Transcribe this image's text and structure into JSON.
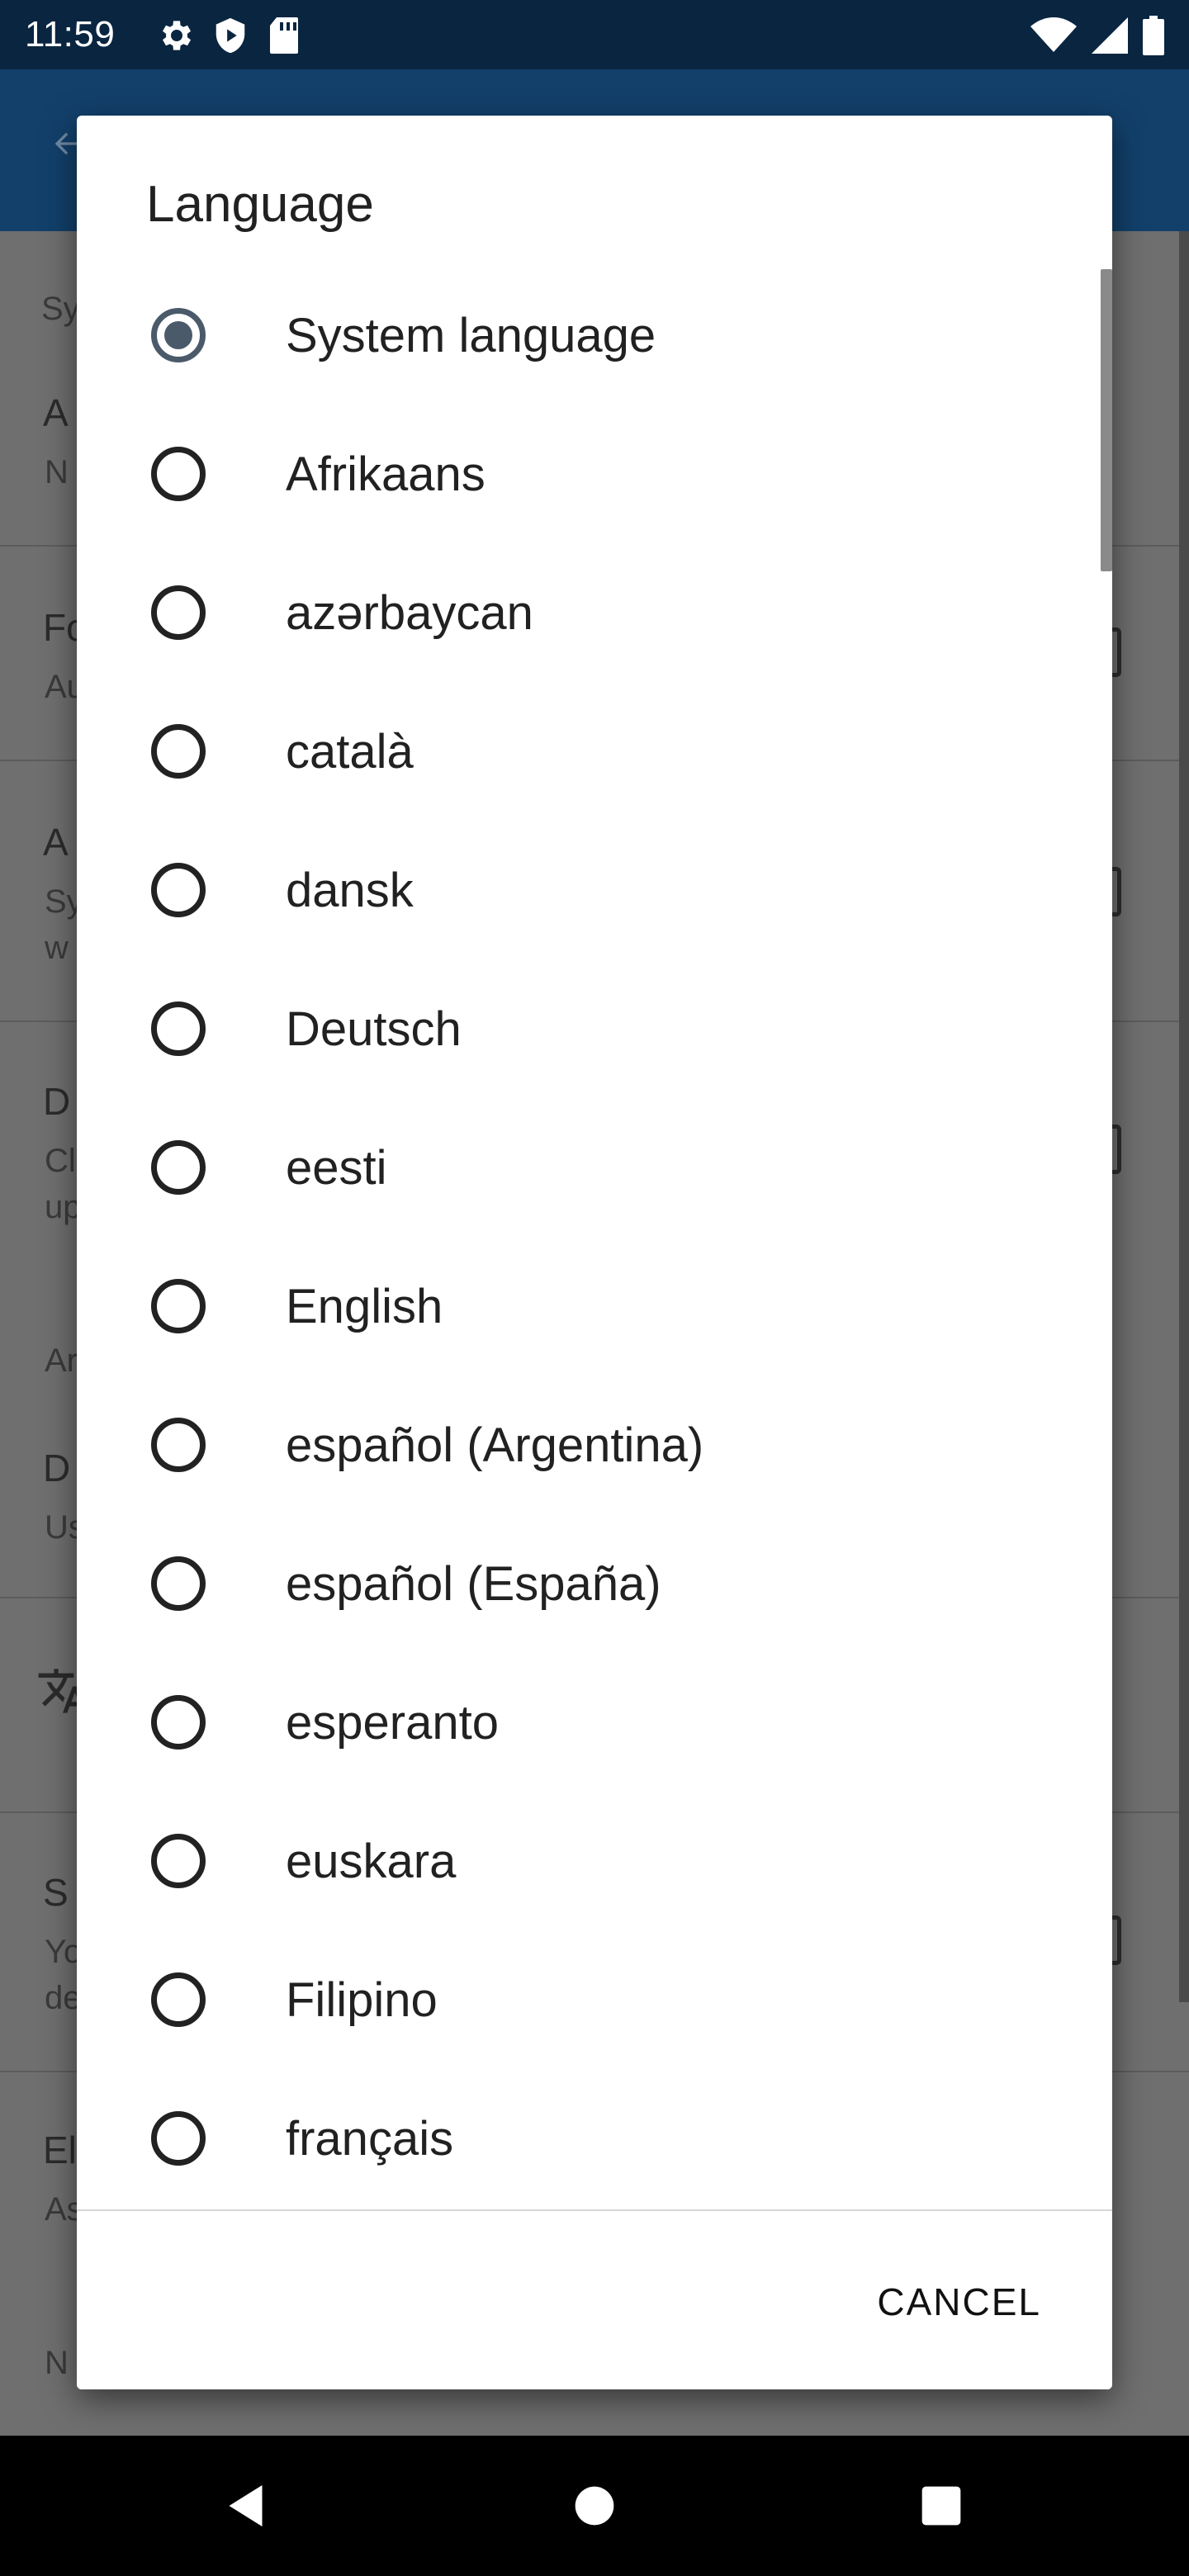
{
  "status_bar": {
    "time": "11:59",
    "left_icons": [
      "settings-icon",
      "shield-icon",
      "sd-card-icon"
    ],
    "right_icons": [
      "wifi-icon",
      "signal-icon",
      "battery-icon"
    ]
  },
  "background": {
    "fragments": [
      {
        "text": "Sy",
        "style": "small"
      },
      {
        "text": "A",
        "style": "normal"
      },
      {
        "text": "N",
        "style": "small"
      },
      {
        "text": "Fo",
        "style": "normal"
      },
      {
        "text": "Au",
        "style": "small"
      },
      {
        "text": "A",
        "style": "normal"
      },
      {
        "text": "Sy",
        "style": "small"
      },
      {
        "text": "w",
        "style": "small"
      },
      {
        "text": "D",
        "style": "normal"
      },
      {
        "text": "Cl",
        "style": "small"
      },
      {
        "text": "up",
        "style": "small"
      },
      {
        "text": "Ar",
        "style": "small"
      },
      {
        "text": "D",
        "style": "normal"
      },
      {
        "text": "Us",
        "style": "small"
      },
      {
        "text": "S",
        "style": "normal"
      },
      {
        "text": "Yo",
        "style": "small"
      },
      {
        "text": "de",
        "style": "small"
      },
      {
        "text": "El",
        "style": "normal"
      },
      {
        "text": "As",
        "style": "small"
      },
      {
        "text": "N",
        "style": "small"
      }
    ],
    "translate_icon": "translate-icon"
  },
  "dialog": {
    "title": "Language",
    "selected_index": 0,
    "options": [
      {
        "label": "System language"
      },
      {
        "label": "Afrikaans"
      },
      {
        "label": "azərbaycan"
      },
      {
        "label": "català"
      },
      {
        "label": "dansk"
      },
      {
        "label": "Deutsch"
      },
      {
        "label": "eesti"
      },
      {
        "label": "English"
      },
      {
        "label": "español (Argentina)"
      },
      {
        "label": "español (España)"
      },
      {
        "label": "esperanto"
      },
      {
        "label": "euskara"
      },
      {
        "label": "Filipino"
      },
      {
        "label": "français"
      }
    ],
    "cancel_label": "CANCEL"
  },
  "nav_bar": {
    "buttons": [
      "back-icon",
      "home-icon",
      "recents-icon"
    ]
  }
}
